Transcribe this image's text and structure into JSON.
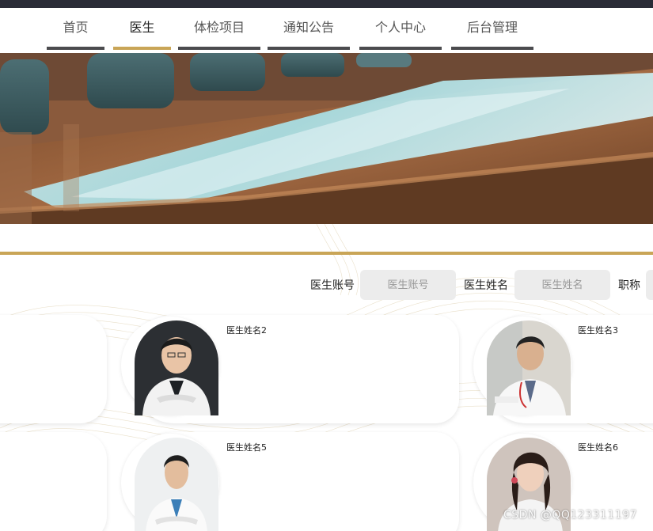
{
  "nav": {
    "items": [
      {
        "label": "首页"
      },
      {
        "label": "医生"
      },
      {
        "label": "体检项目"
      },
      {
        "label": "通知公告"
      },
      {
        "label": "个人中心"
      },
      {
        "label": "后台管理"
      }
    ],
    "active_index": 1
  },
  "search": {
    "account_label": "医生账号",
    "account_placeholder": "医生账号",
    "name_label": "医生姓名",
    "name_placeholder": "医生姓名",
    "title_label": "职称"
  },
  "doctors": [
    {
      "name": "医生姓名2"
    },
    {
      "name": "医生姓名3"
    },
    {
      "name": "医生姓名5"
    },
    {
      "name": "医生姓名6"
    }
  ],
  "watermark": "CSDN @QQ123311197",
  "colors": {
    "accent_gold": "#c9a557",
    "nav_underline": "#4b4b4e",
    "top_bar": "#2a2c37",
    "input_bg": "#ececec"
  }
}
